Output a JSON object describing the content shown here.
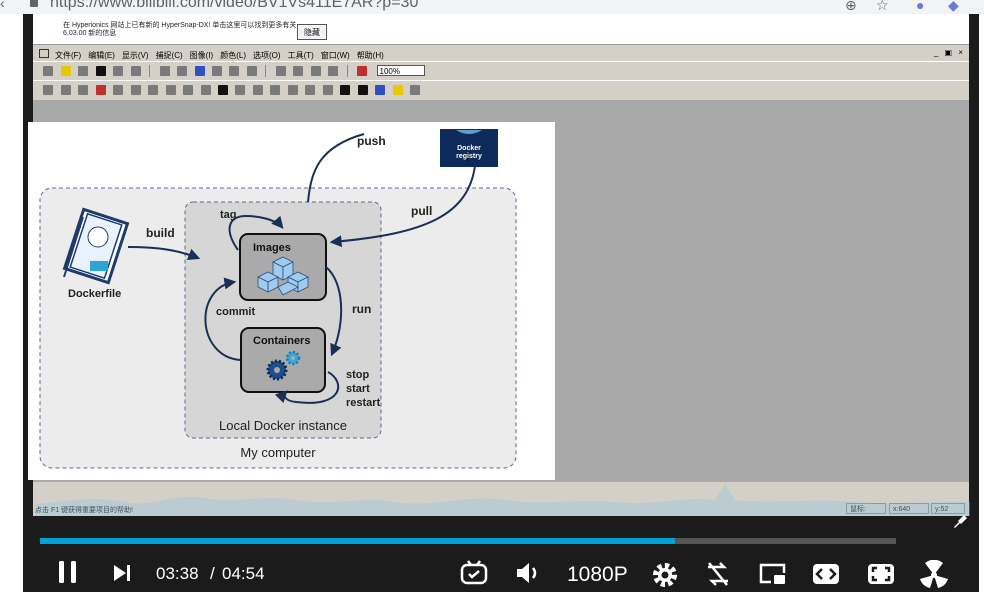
{
  "browser": {
    "url": "https://www.bilibili.com/video/BV1Vs411E7AR?p=30"
  },
  "capture": {
    "notice_text": "在 Hyperionics 网站上已有新的 HyperSnap-DX! 单击这里可以找到更多有关 6.03.00 新的信息",
    "notice_hide_button": "隐藏",
    "menu": [
      "文件(F)",
      "编辑(E)",
      "显示(V)",
      "捕捉(C)",
      "图像(I)",
      "颜色(L)",
      "选项(O)",
      "工具(T)",
      "窗口(W)",
      "帮助(H)"
    ],
    "window_controls": "_ ▣ ×",
    "zoom": "100%",
    "status_hint": "点击 F1 键获得重要项目的帮助!",
    "status_label": "鼠标:",
    "status_x": "x:640",
    "status_y": "y:52"
  },
  "diagram": {
    "push": "push",
    "pull": "pull",
    "tag": "tag",
    "build": "build",
    "commit": "commit",
    "run": "run",
    "stop": "stop",
    "start": "start",
    "restart": "restart",
    "images": "Images",
    "containers": "Containers",
    "dockerfile": "Dockerfile",
    "registry_line1": "Docker",
    "registry_line2": "registry",
    "local_instance": "Local Docker instance",
    "my_computer": "My computer"
  },
  "player": {
    "time_current": "03:38",
    "time_separator": "/",
    "time_total": "04:54",
    "quality": "1080P",
    "progress_fraction": 0.7415
  },
  "colors": {
    "accent": "#00a1d6",
    "arrow": "#1b2f55",
    "registry": "#0d2a5a"
  }
}
